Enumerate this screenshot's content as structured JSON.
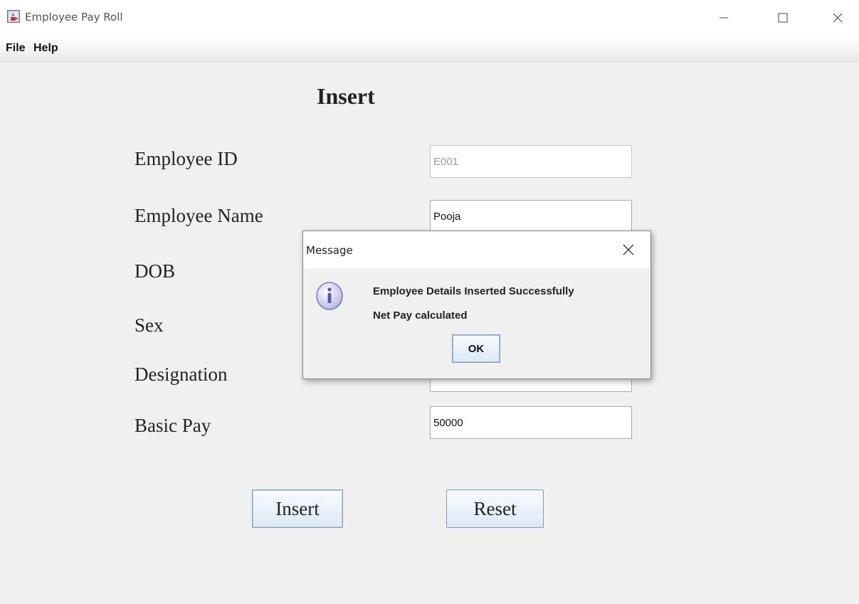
{
  "window": {
    "title": "Employee Pay Roll",
    "icon": "java-cup-icon"
  },
  "menu": {
    "items": [
      {
        "label": "File"
      },
      {
        "label": "Help"
      }
    ]
  },
  "form": {
    "title": "Insert",
    "fields": [
      {
        "label": "Employee ID",
        "value": "E001"
      },
      {
        "label": "Employee Name",
        "value": "Pooja"
      },
      {
        "label": "DOB",
        "value": ""
      },
      {
        "label": "Sex",
        "value": ""
      },
      {
        "label": "Designation",
        "value": ""
      },
      {
        "label": "Basic Pay",
        "value": "50000"
      }
    ],
    "buttons": {
      "insert": "Insert",
      "reset": "Reset"
    }
  },
  "dialog": {
    "title": "Message",
    "icon": "info-icon",
    "lines": [
      "Employee Details Inserted Successfully",
      "Net Pay calculated"
    ],
    "ok_label": "OK"
  }
}
